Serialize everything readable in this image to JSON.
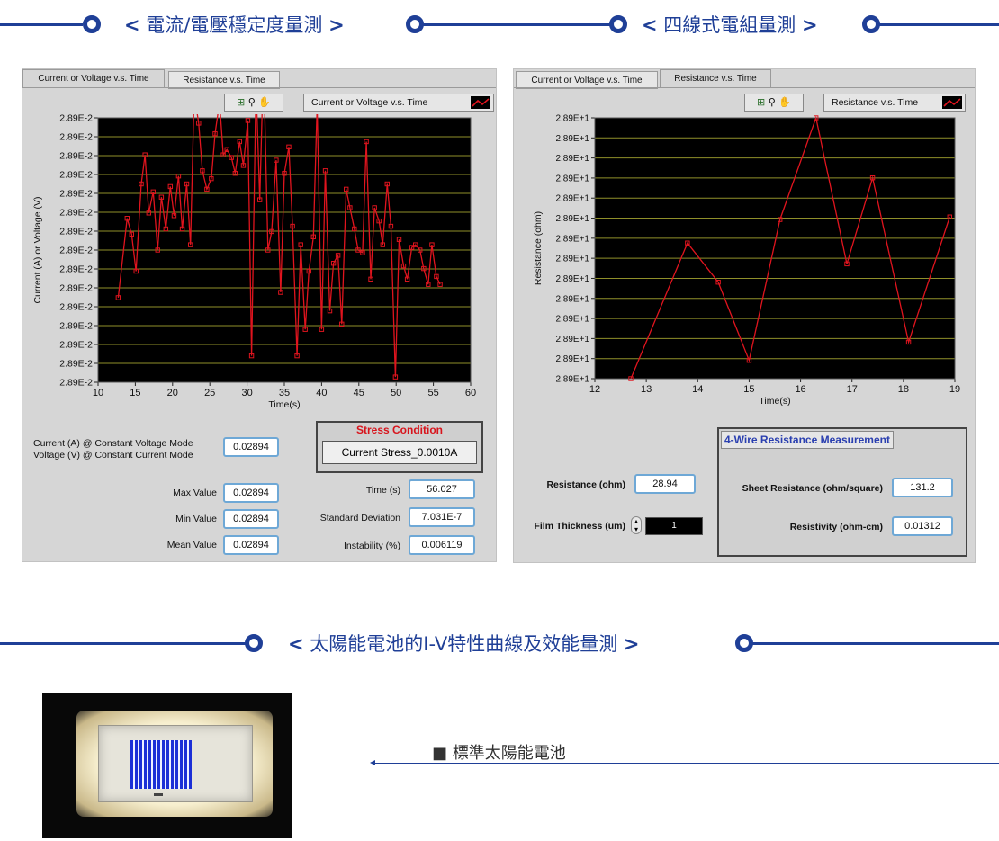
{
  "headings": {
    "stability": "電流/電壓穩定度量測",
    "four_wire": "四線式電組量測",
    "solar": "太陽能電池的I-V特性曲線及效能量測"
  },
  "left_panel": {
    "tabs": [
      "Current or Voltage v.s. Time",
      "Resistance  v.s. Time"
    ],
    "active_tab": 0,
    "tool_icons": "⊞ ⚲ ✋",
    "legend_label": "Current or Voltage  v.s. Time",
    "stress_title": "Stress Condition",
    "stress_value": "Current Stress_0.0010A",
    "mode_label_1": "Current (A) @ Constant Voltage Mode",
    "mode_label_2": "Voltage (V) @ Constant Current Mode",
    "mode_value": "0.02894",
    "max_label": "Max Value",
    "max_value": "0.02894",
    "min_label": "Min Value",
    "min_value": "0.02894",
    "mean_label": "Mean Value",
    "mean_value": "0.02894",
    "time_label": "Time (s)",
    "time_value": "56.027",
    "std_label": "Standard Deviation",
    "std_value": "7.031E-7",
    "instab_label": "Instability (%)",
    "instab_value": "0.006119"
  },
  "right_panel": {
    "tabs": [
      "Current or Voltage v.s. Time",
      "Resistance  v.s. Time"
    ],
    "active_tab": 1,
    "tool_icons": "⊞ ⚲ ✋",
    "legend_label": "Resistance v.s. Time",
    "res_label": "Resistance (ohm)",
    "res_value": "28.94",
    "thick_label": "Film Thickness (um)",
    "thick_value": "1",
    "measure_title": "4-Wire Resistance Measurement",
    "sheet_label": "Sheet Resistance (ohm/square)",
    "sheet_value": "131.2",
    "resistivity_label": "Resistivity (ohm-cm)",
    "resistivity_value": "0.01312"
  },
  "solar": {
    "caption": "■ 標準太陽能電池"
  },
  "colors": {
    "brand_blue": "#1f3f97",
    "plot_bg": "#000000",
    "trace": "#e0141e",
    "grid": "#8f8f2a"
  },
  "chart_data": [
    {
      "type": "line",
      "title": "Current or Voltage  v.s. Time",
      "xlabel": "Time(s)",
      "ylabel": "Current (A) or  Voltage (V)",
      "xlim": [
        10,
        60
      ],
      "xticks": [
        10,
        15,
        20,
        25,
        30,
        35,
        40,
        45,
        50,
        55,
        60
      ],
      "ytick_labels": [
        "2.89E-2",
        "2.89E-2",
        "2.89E-2",
        "2.89E-2",
        "2.89E-2",
        "2.89E-2",
        "2.89E-2",
        "2.89E-2",
        "2.89E-2",
        "2.89E-2",
        "2.89E-2",
        "2.89E-2",
        "2.89E-2",
        "2.89E-2",
        "2.89E-2"
      ],
      "grid": true,
      "series": [
        {
          "x": [
            12.7,
            13.9,
            14.5,
            15.1,
            15.8,
            16.3,
            16.8,
            17.4,
            18.0,
            18.5,
            19.1,
            19.7,
            20.2,
            20.8,
            21.3,
            21.9,
            22.4,
            22.9,
            23.5,
            24.0,
            24.6,
            25.2,
            25.7,
            26.3,
            26.8,
            27.3,
            27.9,
            28.4,
            29.0,
            29.5,
            30.1,
            30.6,
            31.2,
            31.7,
            32.2,
            32.8,
            33.3,
            33.9,
            34.5,
            35.0,
            35.6,
            36.1,
            36.7,
            37.2,
            37.8,
            38.3,
            38.9,
            39.4,
            40.0,
            40.5,
            41.1,
            41.6,
            42.2,
            42.7,
            43.3,
            43.8,
            44.4,
            44.9,
            45.5,
            46.0,
            46.6,
            47.1,
            47.7,
            48.2,
            48.8,
            49.3,
            49.9,
            50.4,
            51.0,
            51.5,
            52.1,
            52.6,
            53.2,
            53.7,
            54.3,
            54.8,
            55.4,
            55.9
          ],
          "y": [
            0.32,
            0.62,
            0.56,
            0.42,
            0.75,
            0.86,
            0.64,
            0.72,
            0.5,
            0.7,
            0.58,
            0.74,
            0.63,
            0.78,
            0.58,
            0.75,
            0.52,
            1.09,
            0.98,
            0.8,
            0.73,
            0.77,
            0.94,
            1.06,
            0.86,
            0.88,
            0.85,
            0.79,
            0.91,
            0.82,
            0.99,
            0.1,
            1.13,
            0.69,
            1.22,
            0.5,
            0.57,
            0.84,
            0.34,
            0.79,
            0.89,
            0.59,
            0.1,
            0.52,
            0.2,
            0.42,
            0.55,
            1.05,
            0.2,
            0.8,
            0.27,
            0.45,
            0.48,
            0.22,
            0.73,
            0.66,
            0.58,
            0.5,
            0.49,
            0.91,
            0.39,
            0.66,
            0.61,
            0.52,
            0.75,
            0.59,
            0.02,
            0.54,
            0.44,
            0.39,
            0.51,
            0.52,
            0.5,
            0.43,
            0.37,
            0.52,
            0.4,
            0.37
          ]
        }
      ]
    },
    {
      "type": "line",
      "title": "Resistance v.s. Time",
      "xlabel": "Time(s)",
      "ylabel": "Resistance (ohm)",
      "xlim": [
        12,
        19
      ],
      "xticks": [
        12,
        13,
        14,
        15,
        16,
        17,
        18,
        19
      ],
      "ytick_labels": [
        "2.89E+1",
        "2.89E+1",
        "2.89E+1",
        "2.89E+1",
        "2.89E+1",
        "2.89E+1",
        "2.89E+1",
        "2.89E+1",
        "2.89E+1",
        "2.89E+1",
        "2.89E+1",
        "2.89E+1",
        "2.89E+1",
        "2.89E+1"
      ],
      "grid": true,
      "series": [
        {
          "x": [
            12.7,
            13.8,
            14.4,
            15.0,
            15.6,
            16.3,
            16.9,
            17.4,
            18.1,
            18.9
          ],
          "y": [
            0.0,
            0.52,
            0.37,
            0.07,
            0.61,
            1.0,
            0.44,
            0.77,
            0.14,
            0.62
          ]
        }
      ]
    }
  ]
}
